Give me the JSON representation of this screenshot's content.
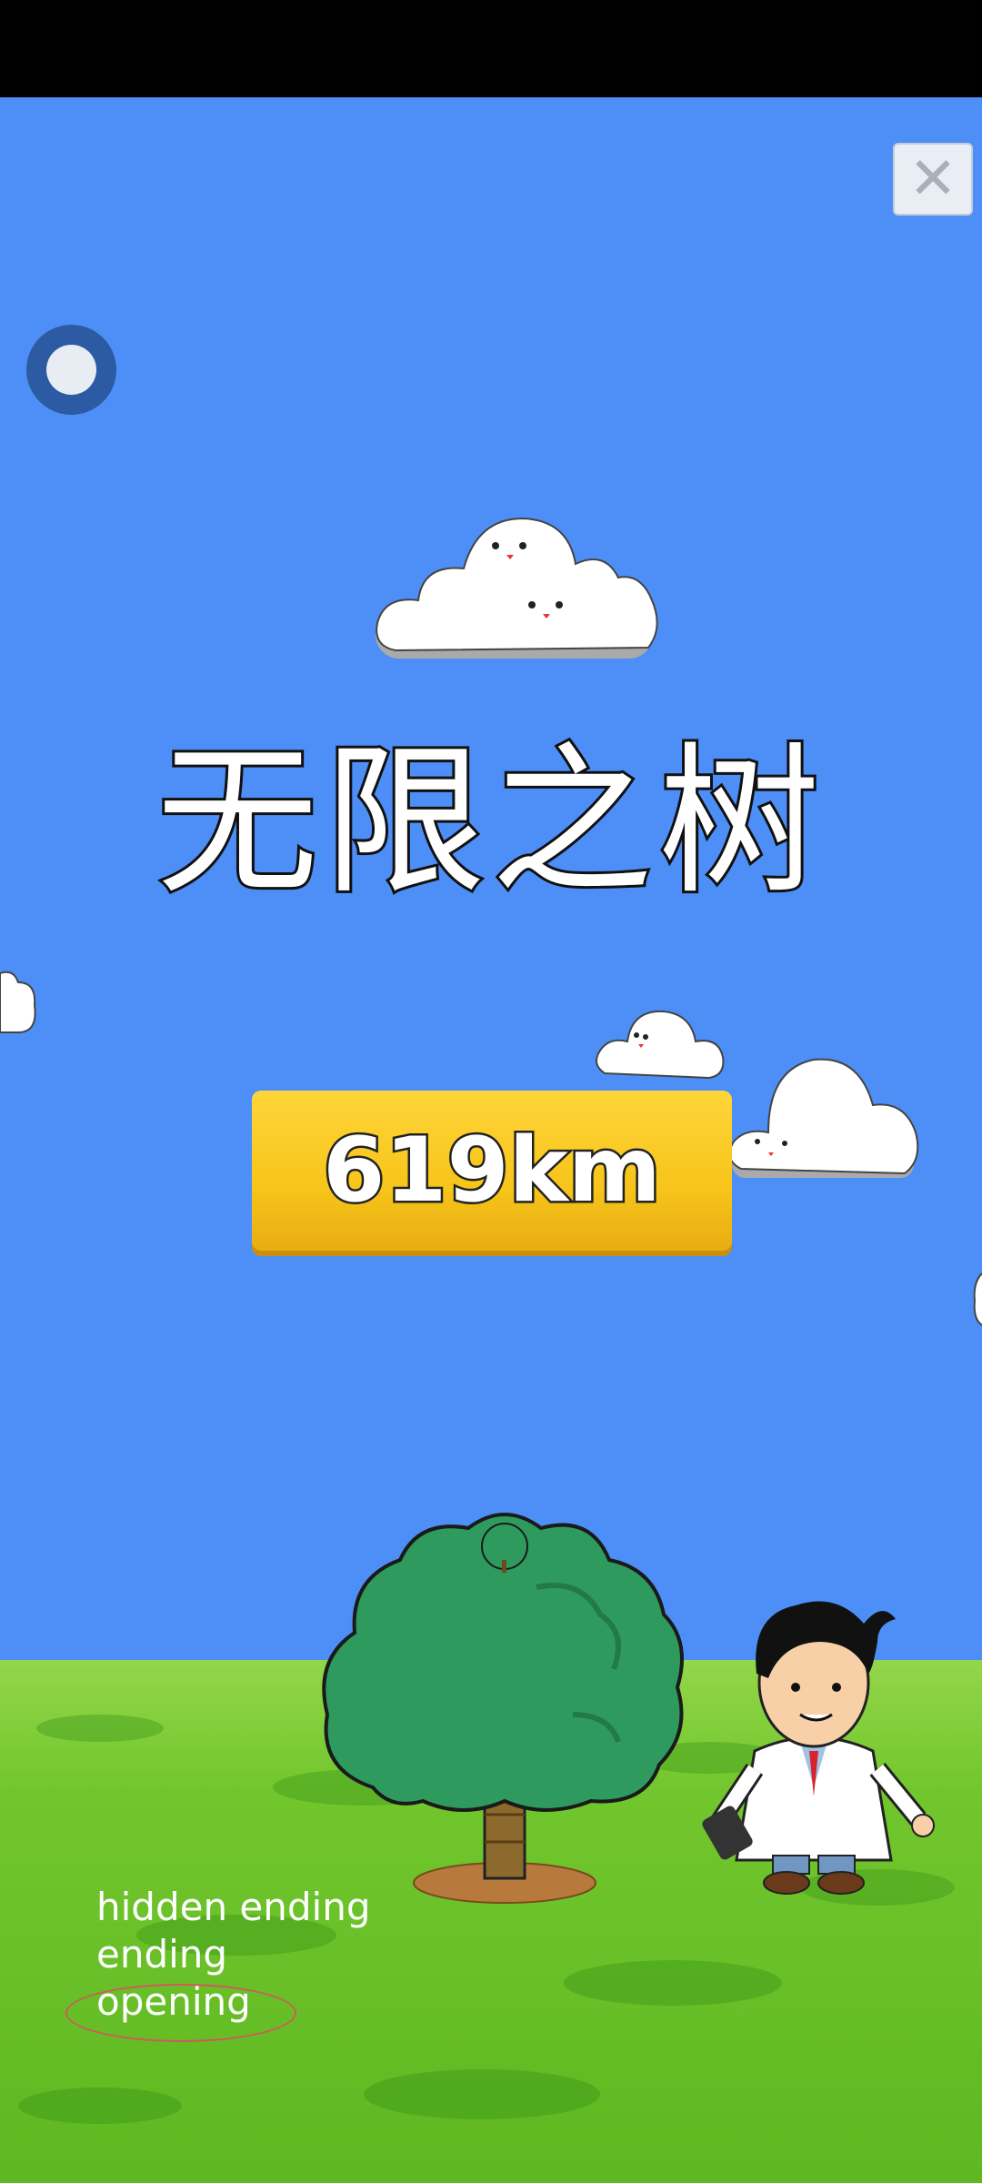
{
  "game": {
    "title": "无限之树",
    "distance": "619km"
  },
  "menu": {
    "items": [
      {
        "label": "hidden ending"
      },
      {
        "label": "ending"
      },
      {
        "label": "opening"
      }
    ]
  },
  "icons": {
    "close": "close-icon",
    "toggle": "toggle-icon"
  },
  "colors": {
    "sky": "#4d8ff7",
    "grass": "#72c62d",
    "distance_button": "#f7c51a",
    "selection_ring": "#d25a5a"
  }
}
